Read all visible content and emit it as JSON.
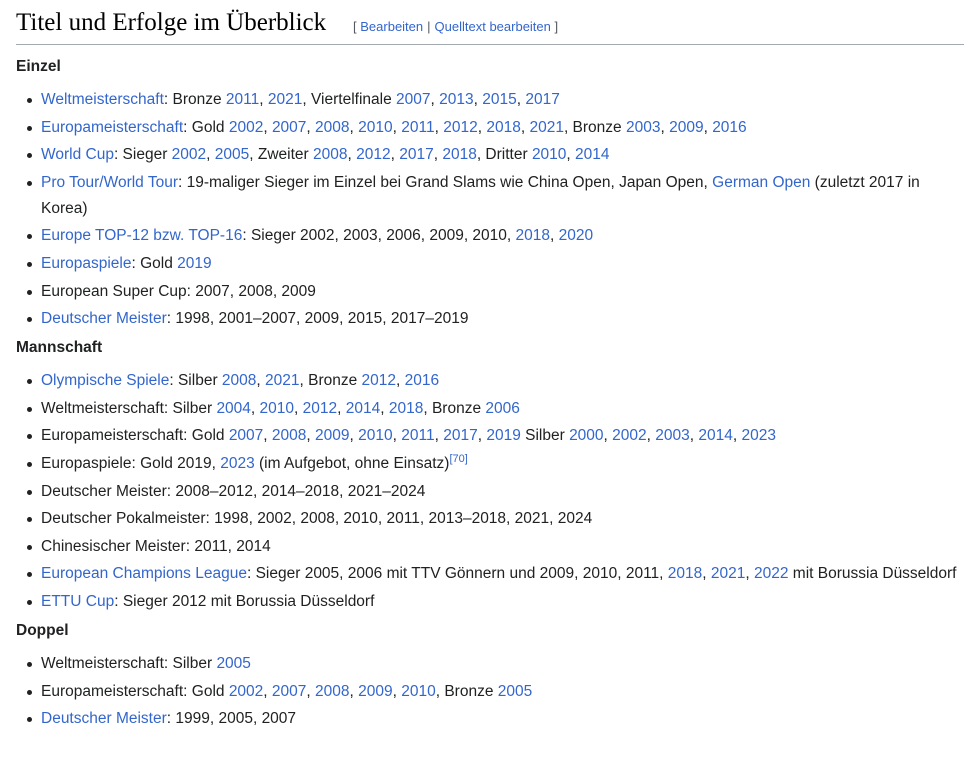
{
  "heading": {
    "title": "Titel und Erfolge im Überblick",
    "edit_open": "[",
    "edit_label": "Bearbeiten",
    "edit_separator": "|",
    "source_edit_label": "Quelltext bearbeiten",
    "edit_close": "]"
  },
  "sections": [
    {
      "title": "Einzel",
      "items": [
        {
          "parts": [
            {
              "t": "Weltmeisterschaft",
              "link": true
            },
            {
              "t": ": Bronze "
            },
            {
              "t": "2011",
              "link": true
            },
            {
              "t": ", "
            },
            {
              "t": "2021",
              "link": true
            },
            {
              "t": ", Viertelfinale "
            },
            {
              "t": "2007",
              "link": true
            },
            {
              "t": ", "
            },
            {
              "t": "2013",
              "link": true
            },
            {
              "t": ", "
            },
            {
              "t": "2015",
              "link": true
            },
            {
              "t": ", "
            },
            {
              "t": "2017",
              "link": true
            }
          ]
        },
        {
          "parts": [
            {
              "t": "Europameisterschaft",
              "link": true
            },
            {
              "t": ": Gold "
            },
            {
              "t": "2002",
              "link": true
            },
            {
              "t": ", "
            },
            {
              "t": "2007",
              "link": true
            },
            {
              "t": ", "
            },
            {
              "t": "2008",
              "link": true
            },
            {
              "t": ", "
            },
            {
              "t": "2010",
              "link": true
            },
            {
              "t": ", "
            },
            {
              "t": "2011",
              "link": true
            },
            {
              "t": ", "
            },
            {
              "t": "2012",
              "link": true
            },
            {
              "t": ", "
            },
            {
              "t": "2018",
              "link": true
            },
            {
              "t": ", "
            },
            {
              "t": "2021",
              "link": true
            },
            {
              "t": ", Bronze "
            },
            {
              "t": "2003",
              "link": true
            },
            {
              "t": ", "
            },
            {
              "t": "2009",
              "link": true
            },
            {
              "t": ", "
            },
            {
              "t": "2016",
              "link": true
            }
          ]
        },
        {
          "parts": [
            {
              "t": "World Cup",
              "link": true
            },
            {
              "t": ": Sieger "
            },
            {
              "t": "2002",
              "link": true
            },
            {
              "t": ", "
            },
            {
              "t": "2005",
              "link": true
            },
            {
              "t": ", Zweiter "
            },
            {
              "t": "2008",
              "link": true
            },
            {
              "t": ", "
            },
            {
              "t": "2012",
              "link": true
            },
            {
              "t": ", "
            },
            {
              "t": "2017",
              "link": true
            },
            {
              "t": ", "
            },
            {
              "t": "2018",
              "link": true
            },
            {
              "t": ", Dritter "
            },
            {
              "t": "2010",
              "link": true
            },
            {
              "t": ", "
            },
            {
              "t": "2014",
              "link": true
            }
          ]
        },
        {
          "wrap": true,
          "parts": [
            {
              "t": "Pro Tour/World Tour",
              "link": true
            },
            {
              "t": ": 19-maliger Sieger im Einzel bei Grand Slams wie China Open, Japan Open, "
            },
            {
              "t": "German Open",
              "link": true
            },
            {
              "t": " (zuletzt 2017 in Korea)"
            }
          ]
        },
        {
          "parts": [
            {
              "t": "Europe TOP-12 bzw. TOP-16",
              "link": true
            },
            {
              "t": ": Sieger 2002, 2003, 2006, 2009, 2010, "
            },
            {
              "t": "2018",
              "link": true
            },
            {
              "t": ", "
            },
            {
              "t": "2020",
              "link": true
            }
          ]
        },
        {
          "parts": [
            {
              "t": "Europaspiele",
              "link": true
            },
            {
              "t": ": Gold "
            },
            {
              "t": "2019",
              "link": true
            }
          ]
        },
        {
          "parts": [
            {
              "t": "European Super Cup: 2007, 2008, 2009"
            }
          ]
        },
        {
          "parts": [
            {
              "t": "Deutscher Meister",
              "link": true
            },
            {
              "t": ": 1998, 2001–2007, 2009, 2015, 2017–2019"
            }
          ]
        }
      ]
    },
    {
      "title": "Mannschaft",
      "items": [
        {
          "parts": [
            {
              "t": "Olympische Spiele",
              "link": true
            },
            {
              "t": ": Silber "
            },
            {
              "t": "2008",
              "link": true
            },
            {
              "t": ", "
            },
            {
              "t": "2021",
              "link": true
            },
            {
              "t": ", Bronze "
            },
            {
              "t": "2012",
              "link": true
            },
            {
              "t": ", "
            },
            {
              "t": "2016",
              "link": true
            }
          ]
        },
        {
          "parts": [
            {
              "t": "Weltmeisterschaft: Silber "
            },
            {
              "t": "2004",
              "link": true
            },
            {
              "t": ", "
            },
            {
              "t": "2010",
              "link": true
            },
            {
              "t": ", "
            },
            {
              "t": "2012",
              "link": true
            },
            {
              "t": ", "
            },
            {
              "t": "2014",
              "link": true
            },
            {
              "t": ", "
            },
            {
              "t": "2018",
              "link": true
            },
            {
              "t": ", Bronze "
            },
            {
              "t": "2006",
              "link": true
            }
          ]
        },
        {
          "parts": [
            {
              "t": "Europameisterschaft: Gold "
            },
            {
              "t": "2007",
              "link": true
            },
            {
              "t": ", "
            },
            {
              "t": "2008",
              "link": true
            },
            {
              "t": ", "
            },
            {
              "t": "2009",
              "link": true
            },
            {
              "t": ", "
            },
            {
              "t": "2010",
              "link": true
            },
            {
              "t": ", "
            },
            {
              "t": "2011",
              "link": true
            },
            {
              "t": ", "
            },
            {
              "t": "2017",
              "link": true
            },
            {
              "t": ", "
            },
            {
              "t": "2019",
              "link": true
            },
            {
              "t": " Silber "
            },
            {
              "t": "2000",
              "link": true
            },
            {
              "t": ", "
            },
            {
              "t": "2002",
              "link": true
            },
            {
              "t": ", "
            },
            {
              "t": "2003",
              "link": true
            },
            {
              "t": ", "
            },
            {
              "t": "2014",
              "link": true
            },
            {
              "t": ", "
            },
            {
              "t": "2023",
              "link": true
            }
          ]
        },
        {
          "parts": [
            {
              "t": "Europaspiele: Gold 2019, "
            },
            {
              "t": "2023",
              "link": true
            },
            {
              "t": " (im Aufgebot, ohne Einsatz)"
            },
            {
              "t": "[70]",
              "link": true,
              "sup": true
            }
          ]
        },
        {
          "parts": [
            {
              "t": "Deutscher Meister: 2008–2012, 2014–2018, 2021–2024"
            }
          ]
        },
        {
          "parts": [
            {
              "t": "Deutscher Pokalmeister: 1998, 2002, 2008, 2010, 2011, 2013–2018, 2021, 2024"
            }
          ]
        },
        {
          "parts": [
            {
              "t": "Chinesischer Meister: 2011, 2014"
            }
          ]
        },
        {
          "wrap": true,
          "parts": [
            {
              "t": "European Champions League",
              "link": true
            },
            {
              "t": ": Sieger 2005, 2006 mit TTV Gönnern und 2009, 2010, 2011, "
            },
            {
              "t": "2018",
              "link": true
            },
            {
              "t": ", "
            },
            {
              "t": "2021",
              "link": true
            },
            {
              "t": ", "
            },
            {
              "t": "2022",
              "link": true
            },
            {
              "t": " mit Borussia Düsseldorf"
            }
          ]
        },
        {
          "parts": [
            {
              "t": "ETTU Cup",
              "link": true
            },
            {
              "t": ": Sieger 2012 mit Borussia Düsseldorf"
            }
          ]
        }
      ]
    },
    {
      "title": "Doppel",
      "items": [
        {
          "parts": [
            {
              "t": "Weltmeisterschaft: Silber "
            },
            {
              "t": "2005",
              "link": true
            }
          ]
        },
        {
          "parts": [
            {
              "t": "Europameisterschaft: Gold "
            },
            {
              "t": "2002",
              "link": true
            },
            {
              "t": ", "
            },
            {
              "t": "2007",
              "link": true
            },
            {
              "t": ", "
            },
            {
              "t": "2008",
              "link": true
            },
            {
              "t": ", "
            },
            {
              "t": "2009",
              "link": true
            },
            {
              "t": ", "
            },
            {
              "t": "2010",
              "link": true
            },
            {
              "t": ", Bronze "
            },
            {
              "t": "2005",
              "link": true
            }
          ]
        },
        {
          "parts": [
            {
              "t": "Deutscher Meister",
              "link": true
            },
            {
              "t": ": 1999, 2005, 2007"
            }
          ]
        }
      ]
    }
  ]
}
